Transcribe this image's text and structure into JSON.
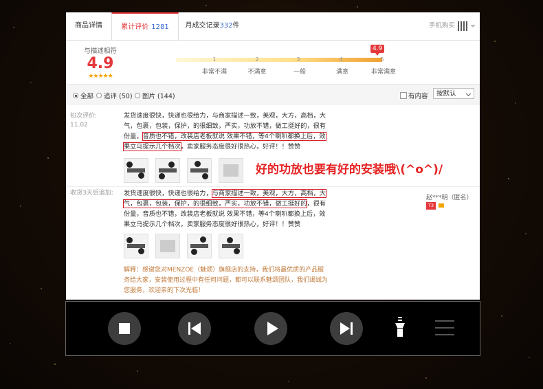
{
  "tabs": {
    "details": "商品详情",
    "reviews_label": "累计评价",
    "reviews_count": "1281",
    "sales_label": "月成交记录",
    "sales_count": "332",
    "sales_unit": "件",
    "mobile_buy": "手机购买"
  },
  "rating": {
    "label": "与描述相符",
    "score": "4.9",
    "stars": "★★★★★",
    "bubble": "4.9",
    "ticks": [
      "1",
      "2",
      "3",
      "4",
      "5"
    ],
    "levels": [
      "非常不满",
      "不满意",
      "一般",
      "满意",
      "非常满意"
    ]
  },
  "filters": {
    "all": "全部",
    "followup": "追评 (50)",
    "images": "图片 (144)",
    "has_content": "有内容",
    "sort": "按默认"
  },
  "review1": {
    "label": "初次评价:",
    "date": "11.02",
    "text_a": "发货速度很快，快递也很给力，与商家描述一致，美观，大方，高档，大气，包裹，包装，保护，的很细致，严实，功放不错，做工挺好的，很有份量，",
    "text_hl1": "音质也不错，改装店老板就说 效果不错，等4个喇叭都换上后，效果立马提示几个档次",
    "text_b": "，卖家服务态度很好很热心，好评！！赞赞"
  },
  "review2": {
    "label": "收货3天后追加:",
    "text_a": "发货速度很快，快递也很给力，",
    "text_hl1": "与商家描述一致，美观，大方，高档，大气，包裹，包装，保护，的很细致，严实，功放不错，做工挺好的",
    "text_b": "，很有份量，音质也不错，改装店老板就说 效果不错，等4个喇叭都换上后，效果立马提示几个档次，卖家服务态度很好很热心，好评！！赞赞"
  },
  "user": {
    "name": "赵***明（匿名）",
    "badge": "T3"
  },
  "reply": "解释：感谢您对MENZOE（魅颂）旗舰店的支持，我们将最优质的产品服务给大家，安装使用过程中有任何问题，都可以联系魅颂团队，我们竭诚为您服务，欢迎亲的下次光临！",
  "callout": "好的功放也要有好的安装哦\\(^o^)/"
}
